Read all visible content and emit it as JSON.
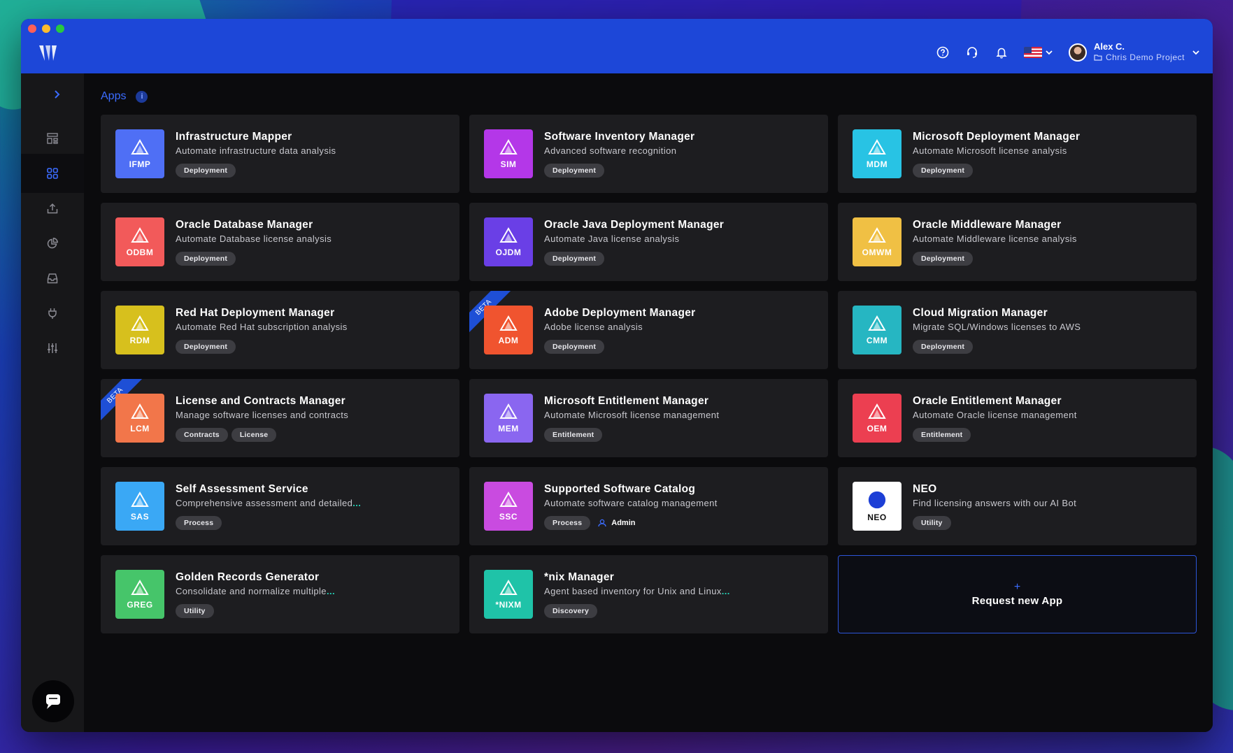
{
  "user": {
    "name": "Alex C.",
    "project": "Chris Demo Project"
  },
  "breadcrumb": {
    "label": "Apps",
    "info": "i"
  },
  "sidebar": {
    "items": [
      {
        "icon": "dashboard-icon"
      },
      {
        "icon": "apps-grid-icon",
        "active": true
      },
      {
        "icon": "upload-icon"
      },
      {
        "icon": "pie-chart-icon"
      },
      {
        "icon": "inbox-icon"
      },
      {
        "icon": "plug-icon"
      },
      {
        "icon": "sliders-icon"
      }
    ]
  },
  "apps": [
    {
      "abbr": "IFMP",
      "title": "Infrastructure Mapper",
      "desc": "Automate infrastructure data analysis",
      "tags": [
        "Deployment"
      ],
      "color": "#4f6ff5",
      "beta": false
    },
    {
      "abbr": "SIM",
      "title": "Software Inventory Manager",
      "desc": "Advanced software recognition",
      "tags": [
        "Deployment"
      ],
      "color": "#b437e8",
      "beta": false
    },
    {
      "abbr": "MDM",
      "title": "Microsoft Deployment Manager",
      "desc": "Automate Microsoft license analysis",
      "tags": [
        "Deployment"
      ],
      "color": "#28c3e4",
      "beta": false
    },
    {
      "abbr": "ODBM",
      "title": "Oracle Database Manager",
      "desc": "Automate Database license analysis",
      "tags": [
        "Deployment"
      ],
      "color": "#f25a5a",
      "beta": false
    },
    {
      "abbr": "OJDM",
      "title": "Oracle Java Deployment Manager",
      "desc": "Automate Java license analysis",
      "tags": [
        "Deployment"
      ],
      "color": "#6a3fe6",
      "beta": false
    },
    {
      "abbr": "OMWM",
      "title": "Oracle Middleware Manager",
      "desc": "Automate Middleware license analysis",
      "tags": [
        "Deployment"
      ],
      "color": "#f0c044",
      "beta": false
    },
    {
      "abbr": "RDM",
      "title": "Red Hat Deployment Manager",
      "desc": "Automate Red Hat subscription analysis",
      "tags": [
        "Deployment"
      ],
      "color": "#d7c01d",
      "beta": false
    },
    {
      "abbr": "ADM",
      "title": "Adobe Deployment Manager",
      "desc": "Adobe license analysis",
      "tags": [
        "Deployment"
      ],
      "color": "#f0542f",
      "beta": true
    },
    {
      "abbr": "CMM",
      "title": "Cloud Migration Manager",
      "desc": "Migrate SQL/Windows licenses to AWS",
      "tags": [
        "Deployment"
      ],
      "color": "#26b6c2",
      "beta": false
    },
    {
      "abbr": "LCM",
      "title": "License and Contracts Manager",
      "desc": "Manage software licenses and contracts",
      "tags": [
        "Contracts",
        "License"
      ],
      "color": "#f2764a",
      "beta": true
    },
    {
      "abbr": "MEM",
      "title": "Microsoft Entitlement Manager",
      "desc": "Automate Microsoft license management",
      "tags": [
        "Entitlement"
      ],
      "color": "#8a66f0",
      "beta": false
    },
    {
      "abbr": "OEM",
      "title": "Oracle Entitlement Manager",
      "desc": "Automate Oracle license management",
      "tags": [
        "Entitlement"
      ],
      "color": "#ec3f51",
      "beta": false
    },
    {
      "abbr": "SAS",
      "title": "Self Assessment Service",
      "desc": "Comprehensive assessment and detailed",
      "ellipsis": "...",
      "tags": [
        "Process"
      ],
      "color": "#3aa8f5",
      "beta": false
    },
    {
      "abbr": "SSC",
      "title": "Supported Software Catalog",
      "desc": "Automate software catalog management",
      "tags": [
        "Process"
      ],
      "admin": "Admin",
      "color": "#c94be0",
      "beta": false
    },
    {
      "abbr": "NEO",
      "title": "NEO",
      "desc": "Find licensing answers with our AI Bot",
      "tags": [
        "Utility"
      ],
      "color": "#ffffff",
      "beta": false,
      "neo": true
    },
    {
      "abbr": "GREG",
      "title": "Golden Records Generator",
      "desc": "Consolidate and normalize multiple",
      "ellipsis": "...",
      "tags": [
        "Utility"
      ],
      "color": "#46c56a",
      "beta": false
    },
    {
      "abbr": "*NIXM",
      "title": "*nix Manager",
      "desc": "Agent based inventory for Unix and Linux",
      "ellipsis": "...",
      "tags": [
        "Discovery"
      ],
      "color": "#1fc3a8",
      "beta": false
    }
  ],
  "beta_label": "BETA",
  "request": {
    "plus": "+",
    "label": "Request new App"
  },
  "colors": {
    "topbar": "#1d47d8",
    "accent": "#3b6cff",
    "card_bg": "#1d1d20"
  }
}
